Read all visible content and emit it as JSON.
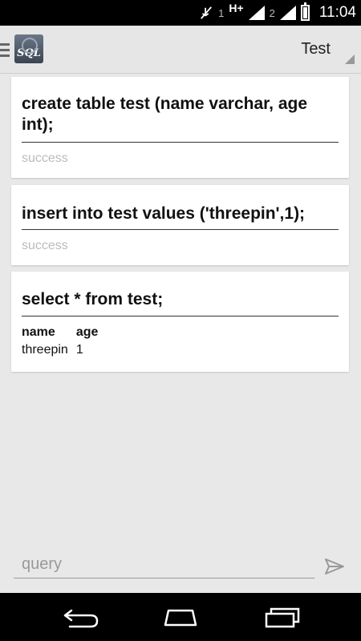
{
  "status_bar": {
    "sim1_label": "1",
    "network_type": "H+",
    "sim2_label": "2",
    "time": "11:04",
    "battery_level": 0.85
  },
  "action_bar": {
    "app_icon_text": "SQL",
    "database_selector": "Test"
  },
  "cards": [
    {
      "query": "create table test (name varchar, age int);",
      "result": "success"
    },
    {
      "query": "insert into test values ('threepin',1);",
      "result": "success"
    },
    {
      "query": "select * from test;",
      "table": {
        "columns": [
          "name",
          "age"
        ],
        "rows": [
          [
            "threepin",
            "1"
          ]
        ]
      }
    }
  ],
  "input": {
    "placeholder": "query",
    "value": ""
  },
  "icons": {
    "menu": "hamburger-icon",
    "send": "send-icon",
    "back": "back-icon",
    "home": "home-icon",
    "recents": "recent-apps-icon"
  }
}
